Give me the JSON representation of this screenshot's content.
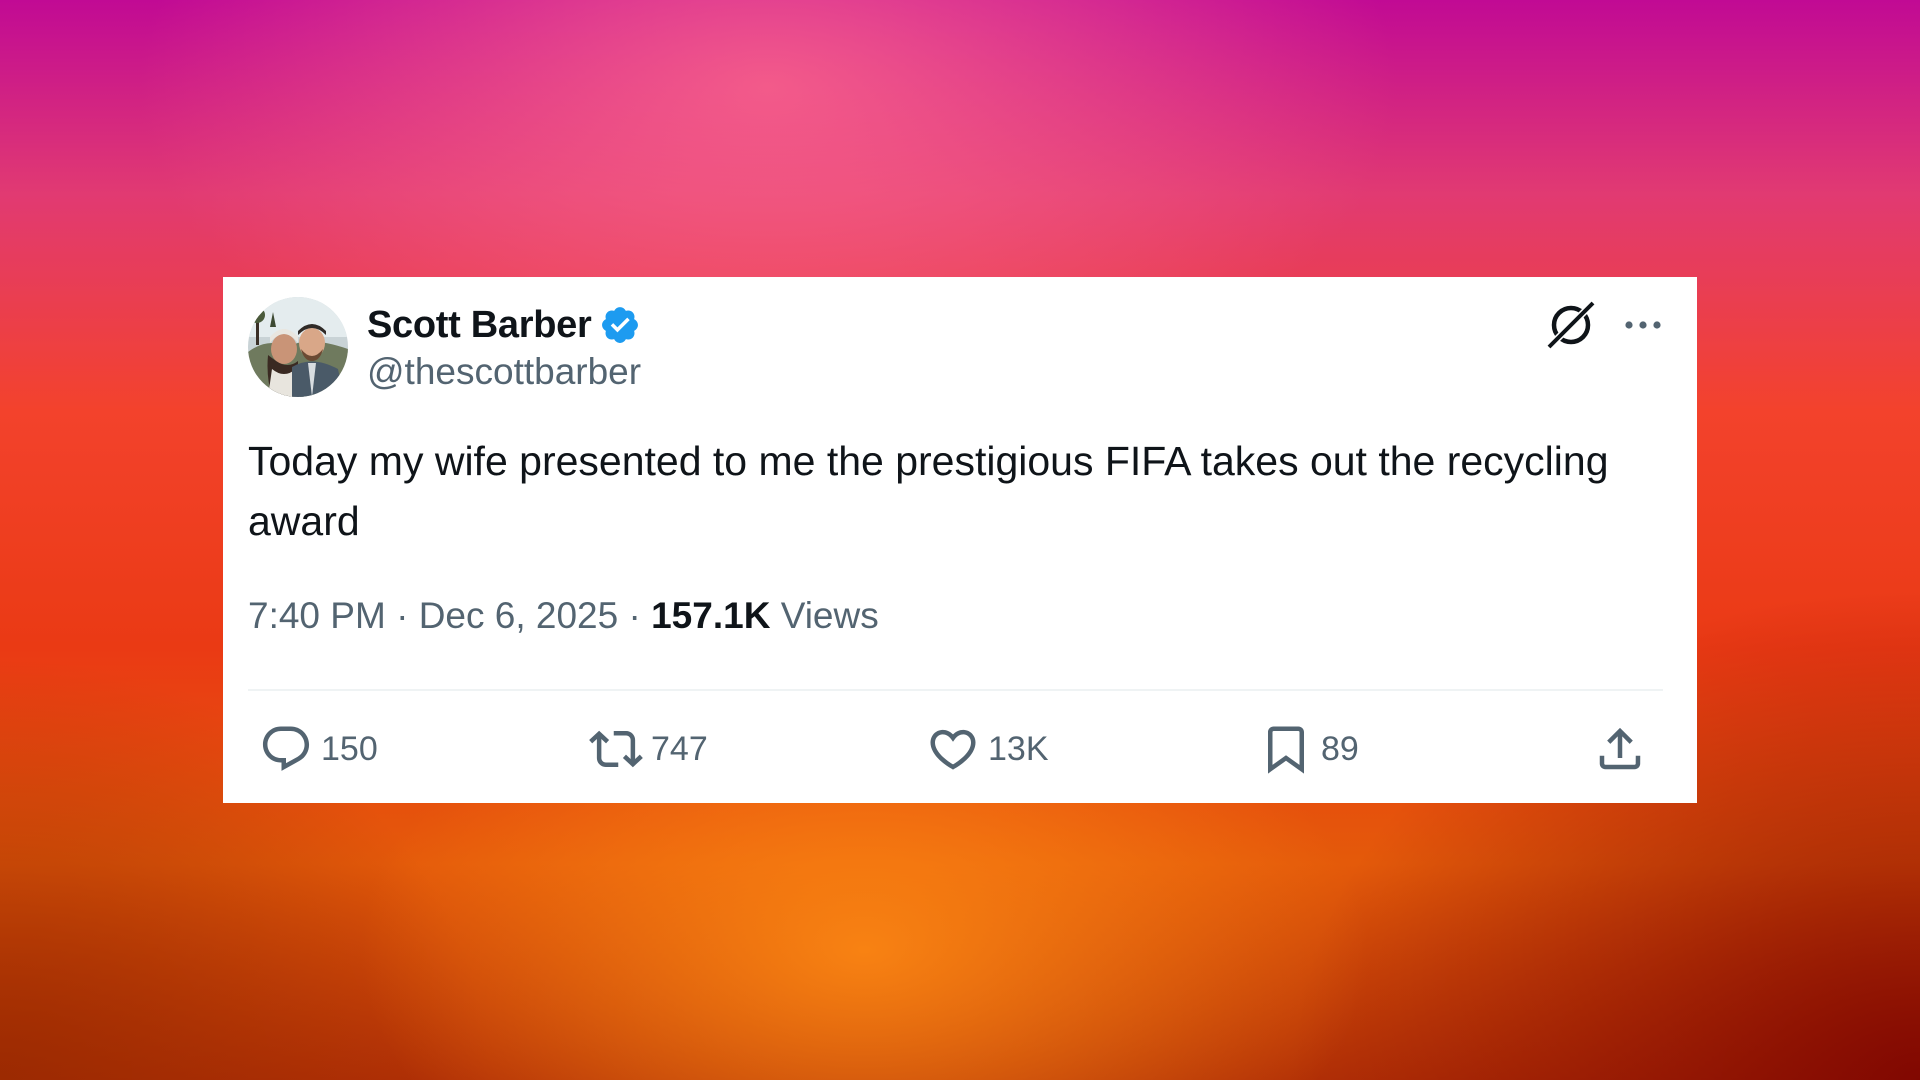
{
  "tweet": {
    "author": {
      "display_name": "Scott Barber",
      "handle": "@thescottbarber",
      "verified": true,
      "verified_color": "#1d9bf0",
      "avatar_icon": "avatar-photo"
    },
    "text": "Today my wife presented to me the prestigious FIFA takes out the recycling award",
    "time": "7:40 PM",
    "separator": "·",
    "date": "Dec 6, 2025",
    "views_count": "157.1K",
    "views_label": "Views",
    "top_icons": [
      "grok-icon",
      "more-icon"
    ],
    "actions": {
      "reply": {
        "icon": "reply-icon",
        "count": "150"
      },
      "retweet": {
        "icon": "retweet-icon",
        "count": "747"
      },
      "like": {
        "icon": "heart-icon",
        "count": "13K"
      },
      "bookmark": {
        "icon": "bookmark-icon",
        "count": "89"
      },
      "share": {
        "icon": "share-icon"
      }
    }
  },
  "colors": {
    "text_primary": "#0f1419",
    "text_secondary": "#536471",
    "card_background": "#ffffff"
  }
}
